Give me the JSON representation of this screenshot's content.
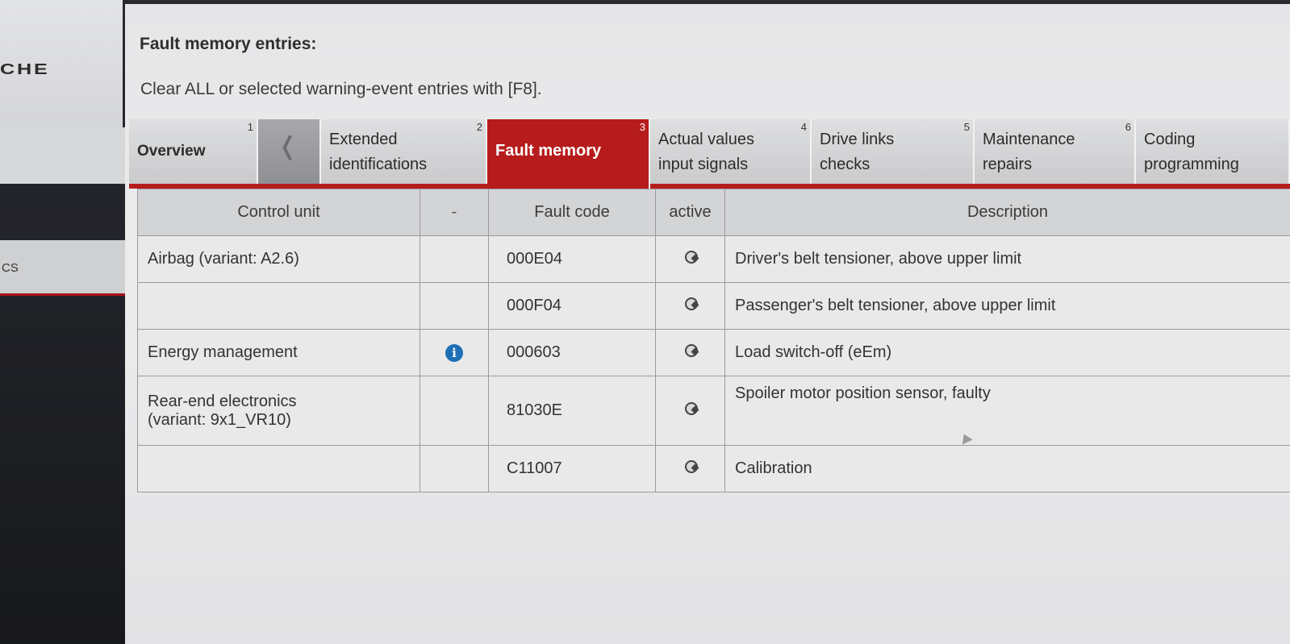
{
  "brand": {
    "logo_fragment": "CHE"
  },
  "sidebar": {
    "item_label": "CS"
  },
  "page": {
    "heading": "Fault memory entries:",
    "instruction": "Clear ALL or selected warning-event entries with [F8]."
  },
  "tabs": [
    {
      "num": "1",
      "label": "Overview"
    },
    {
      "num": "",
      "label": "back"
    },
    {
      "num": "2",
      "label_line1": "Extended",
      "label_line2": "identifications"
    },
    {
      "num": "3",
      "label": "Fault memory",
      "active": true
    },
    {
      "num": "4",
      "label_line1": "Actual values",
      "label_line2": "input signals"
    },
    {
      "num": "5",
      "label_line1": "Drive links",
      "label_line2": "checks"
    },
    {
      "num": "6",
      "label_line1": "Maintenance",
      "label_line2": "repairs"
    },
    {
      "num": "",
      "label_line1": "Coding",
      "label_line2": "programming"
    }
  ],
  "table": {
    "headers": {
      "control_unit": "Control unit",
      "info": "-",
      "fault_code": "Fault code",
      "active": "active",
      "description": "Description"
    },
    "rows": [
      {
        "control_unit": "Airbag (variant: A2.6)",
        "info": "",
        "fault_code": "000E04",
        "active_icon": "bulb-icon",
        "description": "Driver's belt tensioner, above upper limit"
      },
      {
        "control_unit": "",
        "info": "",
        "fault_code": "000F04",
        "active_icon": "bulb-icon",
        "description": "Passenger's belt tensioner, above upper limit"
      },
      {
        "control_unit": "Energy management",
        "info": "info-icon",
        "fault_code": "000603",
        "active_icon": "bulb-icon",
        "description": "Load switch-off (eEm)"
      },
      {
        "control_unit_line1": "Rear-end electronics",
        "control_unit_line2": "(variant: 9x1_VR10)",
        "info": "",
        "fault_code": "81030E",
        "active_icon": "bulb-icon",
        "description": "Spoiler motor position sensor, faulty"
      },
      {
        "control_unit": "",
        "info": "",
        "fault_code": "C11007",
        "active_icon": "bulb-icon",
        "description": "Calibration"
      }
    ]
  },
  "colors": {
    "accent": "#b71c1c",
    "tab_bg": "#d3d4d6",
    "cell_bg": "#e9e9ea",
    "info_icon": "#1f6fb5"
  }
}
